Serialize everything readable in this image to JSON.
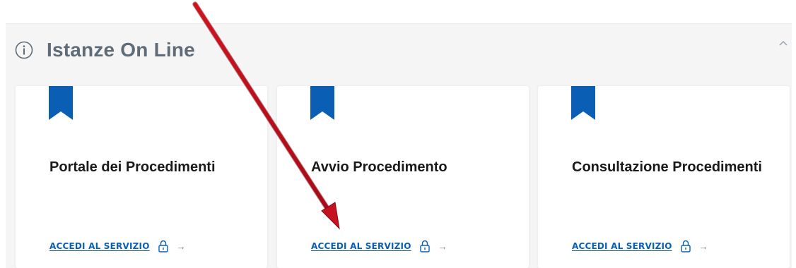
{
  "section": {
    "title": "Istanze On Line"
  },
  "cards": [
    {
      "title": "Portale dei Procedimenti",
      "link_label": "ACCEDI AL SERVIZIO",
      "arrow": "→"
    },
    {
      "title": "Avvio Procedimento",
      "link_label": "ACCEDI AL SERVIZIO",
      "arrow": "→"
    },
    {
      "title": "Consultazione Procedimenti",
      "link_label": "ACCEDI AL SERVIZIO",
      "arrow": "→"
    }
  ],
  "icons": {
    "section": "info-icon",
    "collapse": "chevron-up-icon",
    "card_badge": "bookmark-icon",
    "link_lock": "lock-icon",
    "link_arrow": "arrow-right-icon"
  },
  "colors": {
    "accent_blue": "#0a5fb4",
    "section_title": "#5f6c78",
    "section_background": "#f5f5f6",
    "annotation_arrow": "#c41220"
  }
}
